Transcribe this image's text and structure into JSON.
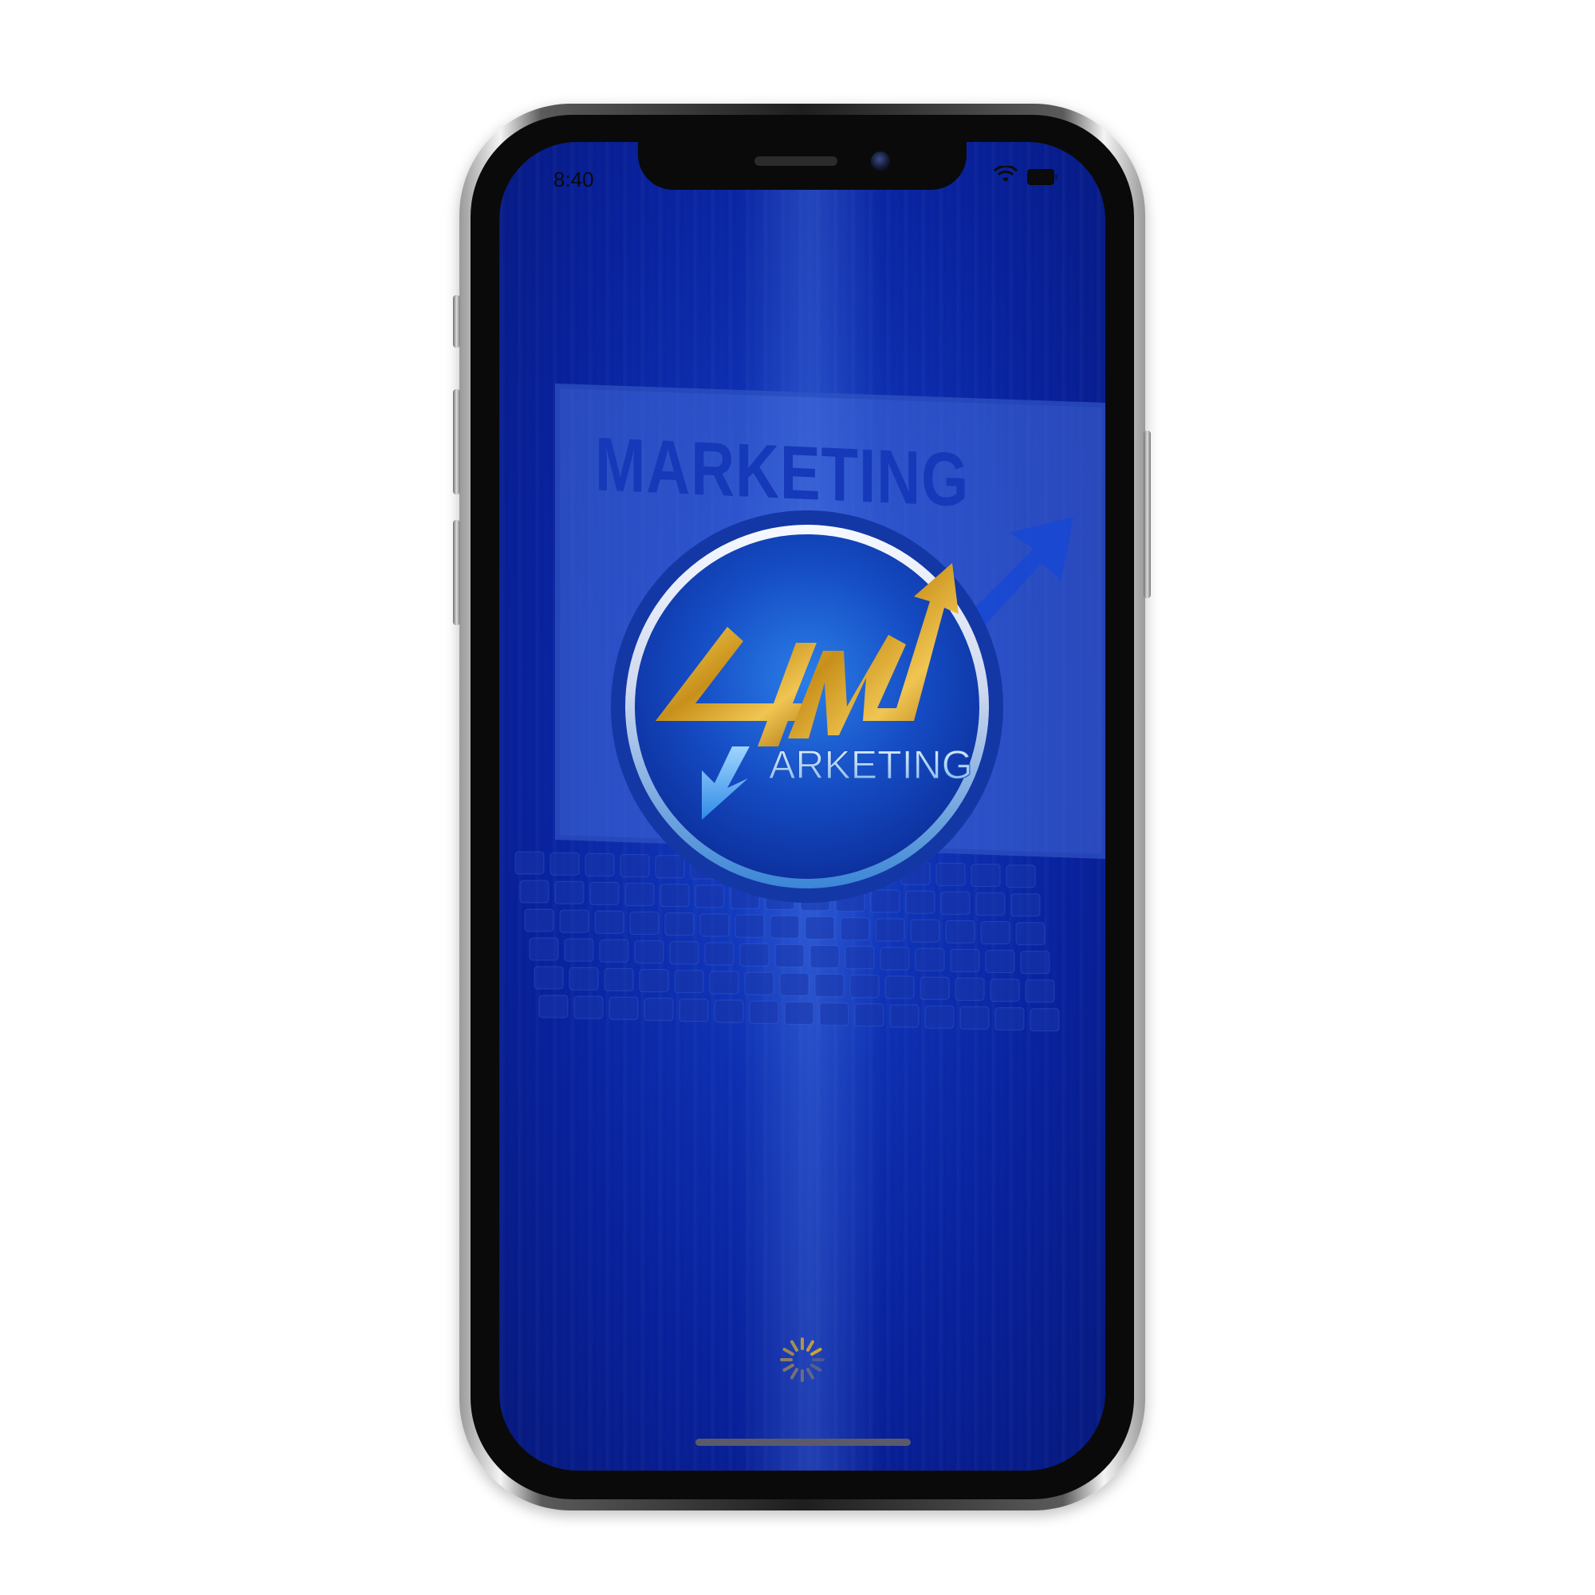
{
  "status_bar": {
    "time": "8:40"
  },
  "background": {
    "laptop_word": "MARKETING"
  },
  "logo": {
    "numeral": "4M",
    "word": "ARKETING"
  },
  "colors": {
    "screen_blue": "#0d2fb0",
    "logo_gold": "#d4a017",
    "logo_ring": "#c9d6ef",
    "spinner_gold": "#c9a23a"
  },
  "icons": [
    "wifi-icon",
    "battery-icon",
    "camera-icon",
    "spinner-icon"
  ],
  "loading": true
}
